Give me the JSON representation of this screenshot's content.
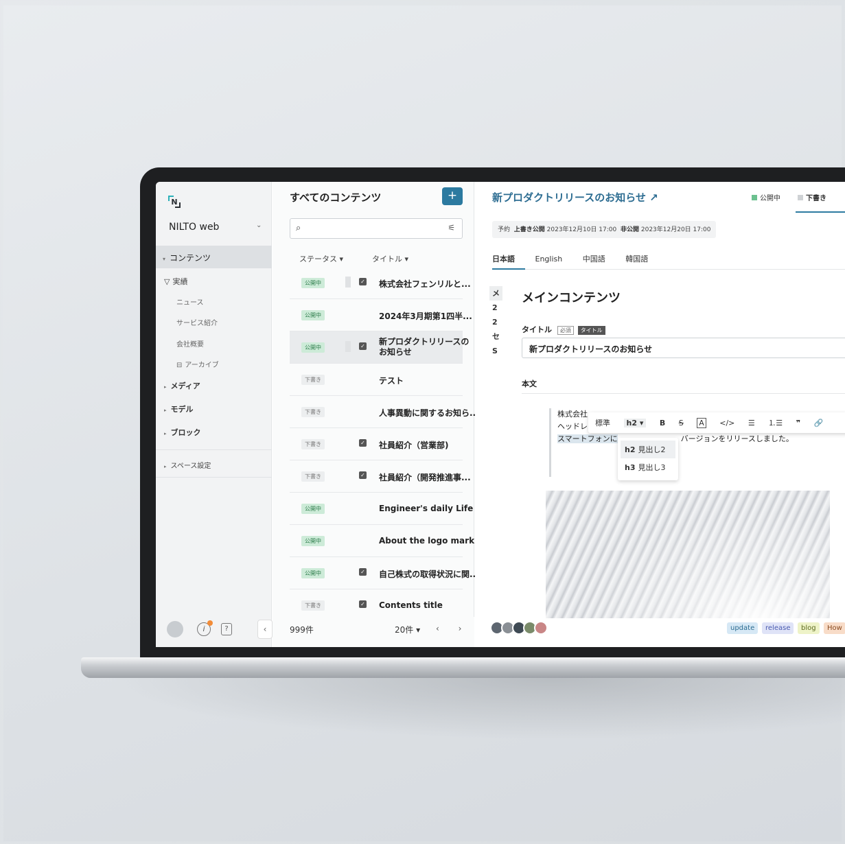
{
  "sidebar": {
    "logo_letter": "N",
    "workspace": "NILTO web",
    "nav_content": "コンテンツ",
    "section_jisseki": "実績",
    "sub_items": [
      "ニュース",
      "サービス紹介",
      "会社概要",
      "アーカイブ"
    ],
    "media": "メディア",
    "model": "モデル",
    "block": "ブロック",
    "space_settings": "スペース設定"
  },
  "list": {
    "title": "すべてのコンテンツ",
    "add": "+",
    "col_status": "ステータス ▾",
    "col_title": "タイトル ▾",
    "rows": [
      {
        "status": "公開中",
        "title": "株式会社フェンリルと..."
      },
      {
        "status": "公開中",
        "title": "2024年3月期第1四半..."
      },
      {
        "status": "公開中",
        "title": "新プロダクトリリースの お知らせ"
      },
      {
        "status": "下書き",
        "title": "テスト"
      },
      {
        "status": "下書き",
        "title": "人事異動に関するお知ら.."
      },
      {
        "status": "下書き",
        "title": "社員紹介（営業部)"
      },
      {
        "status": "下書き",
        "title": "社員紹介（開発推進事..."
      },
      {
        "status": "公開中",
        "title": "Engineer's daily Life"
      },
      {
        "status": "公開中",
        "title": "About the logo mark"
      },
      {
        "status": "公開中",
        "title": "自己株式の取得状況に関.."
      },
      {
        "status": "下書き",
        "title": "Contents title"
      }
    ],
    "count": "999件",
    "per_page": "20件 ▾",
    "pager": "‹ ›"
  },
  "editor": {
    "title": "新プロダクトリリースのお知らせ ↗",
    "status_published": "公開中",
    "status_draft": "下書き",
    "schedule_prefix": "予約",
    "schedule_overwrite_label": "上書き公開",
    "schedule_overwrite_date": "2023年12月10日 17:00",
    "schedule_unpublish_label": "非公開",
    "schedule_unpublish_date": "2023年12月20日 17:00",
    "lang_tabs": [
      "日本語",
      "English",
      "中国語",
      "韓国語"
    ],
    "mini_nav": [
      "メ",
      "2",
      "2",
      "セ",
      "S"
    ],
    "main_heading": "メインコンテンツ",
    "field_title_label": "タイトル",
    "required_badge": "必須",
    "type_badge": "タイトル",
    "title_value": "新プロダクトリリースのお知らせ",
    "body_label": "本文",
    "body_line1": "株式会社",
    "body_line2": "ヘッドレ",
    "body_line3_a": "スマートフォンに",
    "body_line3_b": "バージョンをリリースしました。",
    "toolbar": {
      "normal": "標準",
      "h2": "h2 ▾",
      "bold": "B",
      "strike": "S",
      "text_box": "A",
      "code": "</>",
      "bullet": "☰",
      "numbered": "⒈☰",
      "quote": "❞",
      "link": "🔗"
    },
    "dropdown": [
      {
        "tag": "h2",
        "label": "見出し2"
      },
      {
        "tag": "h3",
        "label": "見出し3"
      }
    ],
    "tags": [
      "update",
      "release",
      "blog",
      "How"
    ],
    "colors": {
      "accent": "#2c7aa0",
      "published": "#6cc18f",
      "draft": "#cfd2d5"
    }
  }
}
